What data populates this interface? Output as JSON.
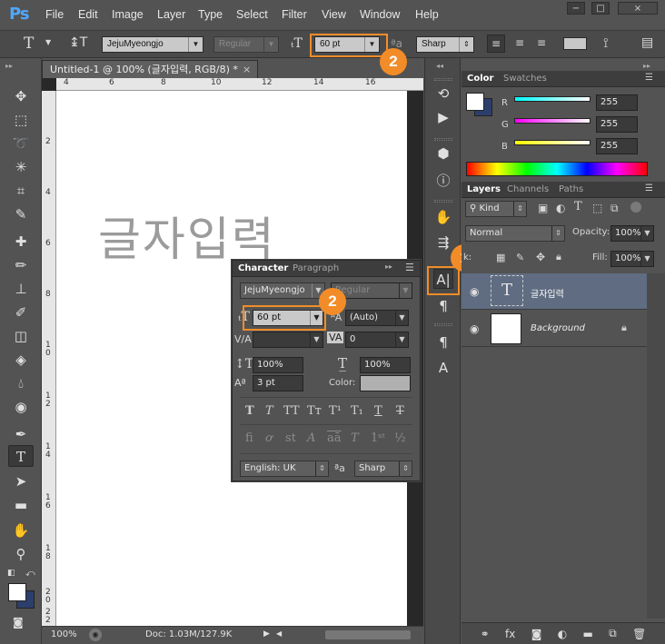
{
  "app": {
    "logo": "Ps",
    "menus": [
      "File",
      "Edit",
      "Image",
      "Layer",
      "Type",
      "Select",
      "Filter",
      "View",
      "Window",
      "Help"
    ],
    "window_controls": [
      "−",
      "□",
      "×"
    ]
  },
  "options_bar": {
    "font_family": "JejuMyeongjo",
    "font_style": "Regular",
    "font_size": "60 pt",
    "anti_alias": "Sharp"
  },
  "document": {
    "tab_title": "Untitled-1 @ 100% (글자입력, RGB/8) *",
    "canvas_text": "글자입력",
    "ruler_marks_h": [
      "4",
      "6",
      "8",
      "10",
      "12",
      "14",
      "16"
    ],
    "ruler_marks_v": [
      "2",
      "4",
      "6",
      "8",
      "1\n0",
      "1\n2",
      "1\n4",
      "1\n6",
      "1\n8",
      "2\n0",
      "2\n2"
    ],
    "zoom": "100%",
    "doc_size": "Doc: 1.03M/127.9K"
  },
  "color_panel": {
    "tabs": [
      "Color",
      "Swatches"
    ],
    "r_label": "R",
    "g_label": "G",
    "b_label": "B",
    "r": "255",
    "g": "255",
    "b": "255"
  },
  "layers_panel": {
    "tabs": [
      "Layers",
      "Channels",
      "Paths"
    ],
    "kind_label": "Kind",
    "blend_mode": "Normal",
    "opacity_label": "Opacity:",
    "opacity": "100%",
    "lock_label": "k:",
    "fill_label": "Fill:",
    "fill": "100%",
    "layers": [
      {
        "name": "글자입력",
        "type": "text",
        "selected": true
      },
      {
        "name": "Background",
        "type": "background",
        "selected": false
      }
    ]
  },
  "character_panel": {
    "tabs": [
      "Character",
      "Paragraph"
    ],
    "font_family": "JejuMyeongjo",
    "font_style": "Regular",
    "font_size": "60 pt",
    "leading": "(Auto)",
    "kerning": "",
    "tracking": "0",
    "vertical_scale": "100%",
    "horizontal_scale": "100%",
    "baseline_shift": "3 pt",
    "color_label": "Color:",
    "language": "English: UK",
    "anti_alias": "Sharp"
  },
  "callouts": [
    "1",
    "2",
    "2"
  ],
  "colors": {
    "accent": "#f28c28",
    "panel_bg": "#535353",
    "selected_layer": "#5f6c81",
    "ps_blue": "#4fa8ff"
  }
}
